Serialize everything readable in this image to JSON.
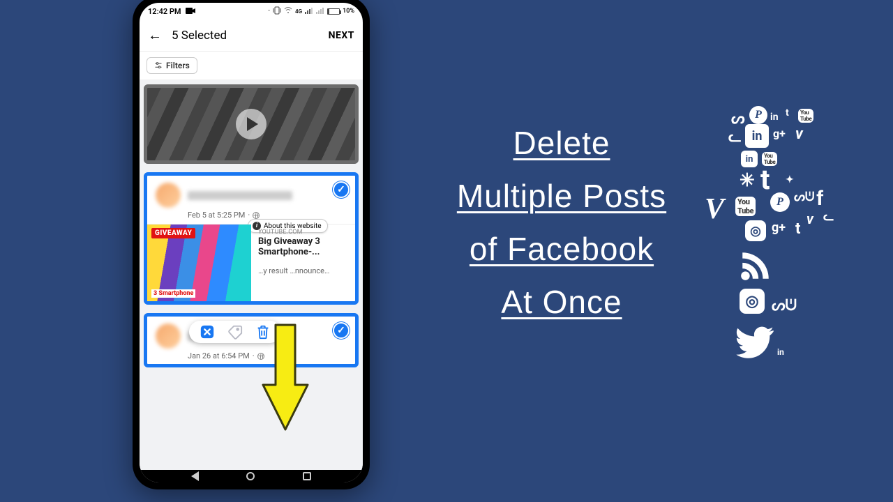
{
  "statusbar": {
    "time": "12:42 PM",
    "battery_pct": "10%",
    "net_label": "4G"
  },
  "toolbar": {
    "title": "5 Selected",
    "next": "NEXT"
  },
  "filters": {
    "label": "Filters"
  },
  "post1": {
    "timestamp": "Feb 5 at 5:25 PM",
    "sep": "·"
  },
  "linkcard": {
    "source": "YOUTUBE.COM",
    "title": "Big Giveaway 3 Smartphone-...",
    "desc": "…y result …nnounce…",
    "giveaway_tag": "GIVEAWAY",
    "smartphone_tag": "3 Smartphone",
    "about": "About this website"
  },
  "post2": {
    "timestamp": "Jan 26 at 6:54 PM",
    "sep": "·"
  },
  "headline": {
    "l1": "Delete",
    "l2": "Multiple Posts",
    "l3": "of Facebook",
    "l4": "At Once"
  }
}
